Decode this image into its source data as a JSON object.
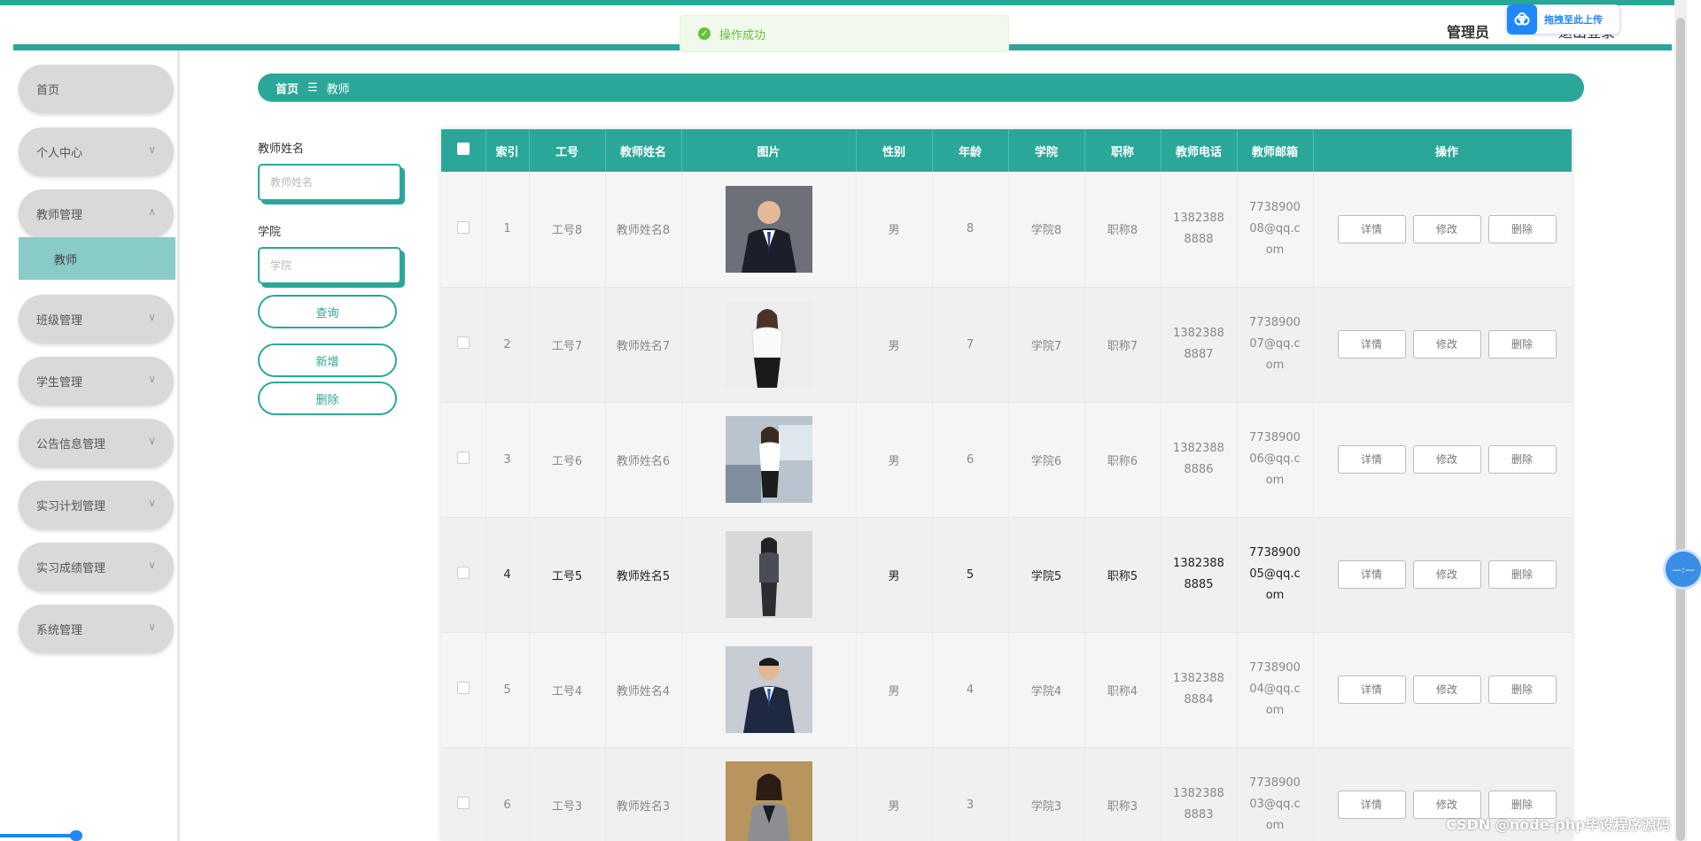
{
  "header": {
    "user_label": "管理员",
    "logout_label": "退出登录"
  },
  "toast": {
    "icon": "check-circle-icon",
    "text": "操作成功"
  },
  "upload_widget": {
    "icon": "cloud-upload-icon",
    "label": "拖拽至此上传"
  },
  "sidebar": {
    "items": [
      {
        "label": "首页",
        "expandable": false
      },
      {
        "label": "个人中心",
        "expandable": true,
        "chevron": "∨"
      },
      {
        "label": "教师管理",
        "expandable": true,
        "chevron": "∧"
      },
      {
        "label": "班级管理",
        "expandable": true,
        "chevron": "∨"
      },
      {
        "label": "学生管理",
        "expandable": true,
        "chevron": "∨"
      },
      {
        "label": "公告信息管理",
        "expandable": true,
        "chevron": "∨"
      },
      {
        "label": "实习计划管理",
        "expandable": true,
        "chevron": "∨"
      },
      {
        "label": "实习成绩管理",
        "expandable": true,
        "chevron": "∨"
      },
      {
        "label": "系统管理",
        "expandable": true,
        "chevron": "∨"
      }
    ],
    "subitem": {
      "label": "教师"
    }
  },
  "breadcrumb": {
    "home": "首页",
    "separator": "☰",
    "current": "教师"
  },
  "search": {
    "name_label": "教师姓名",
    "name_placeholder": "教师姓名",
    "college_label": "学院",
    "college_placeholder": "学院",
    "query_button": "查询",
    "add_button": "新增",
    "delete_button": "删除"
  },
  "table": {
    "headers": [
      "索引",
      "工号",
      "教师姓名",
      "图片",
      "性别",
      "年龄",
      "学院",
      "职称",
      "教师电话",
      "教师邮箱",
      "操作"
    ],
    "actions": {
      "detail": "详情",
      "edit": "修改",
      "delete": "删除"
    },
    "rows": [
      {
        "index": "1",
        "job_no": "工号8",
        "name": "教师姓名8",
        "gender": "男",
        "age": "8",
        "college": "学院8",
        "title": "职称8",
        "phone": "13823888888",
        "email": "773890008@qq.com",
        "photo": "man-dark-suit"
      },
      {
        "index": "2",
        "job_no": "工号7",
        "name": "教师姓名7",
        "gender": "男",
        "age": "7",
        "college": "学院7",
        "title": "职称7",
        "phone": "13823888887",
        "email": "773890007@qq.com",
        "photo": "woman-white-blouse"
      },
      {
        "index": "3",
        "job_no": "工号6",
        "name": "教师姓名6",
        "gender": "男",
        "age": "6",
        "college": "学院6",
        "title": "职称6",
        "phone": "13823888886",
        "email": "773890006@qq.com",
        "photo": "woman-office"
      },
      {
        "index": "4",
        "job_no": "工号5",
        "name": "教师姓名5",
        "gender": "男",
        "age": "5",
        "college": "学院5",
        "title": "职称5",
        "phone": "13823888885",
        "email": "773890005@qq.com",
        "photo": "woman-gray-suit"
      },
      {
        "index": "5",
        "job_no": "工号4",
        "name": "教师姓名4",
        "gender": "男",
        "age": "4",
        "college": "学院4",
        "title": "职称4",
        "phone": "13823888884",
        "email": "773890004@qq.com",
        "photo": "man-navy-suit"
      },
      {
        "index": "6",
        "job_no": "工号3",
        "name": "教师姓名3",
        "gender": "男",
        "age": "3",
        "college": "学院3",
        "title": "职称3",
        "phone": "13823888883",
        "email": "773890003@qq.com",
        "photo": "woman-blazer"
      }
    ]
  },
  "float_ball": {
    "icon": "dash-icon",
    "label": "—:—"
  },
  "watermark": "CSDN @node-php毕设程序源码",
  "colors": {
    "primary": "#2ba79a",
    "submenu_active": "#89cbc6",
    "toast_green": "#67c23a",
    "upload_blue": "#1e88ff"
  }
}
